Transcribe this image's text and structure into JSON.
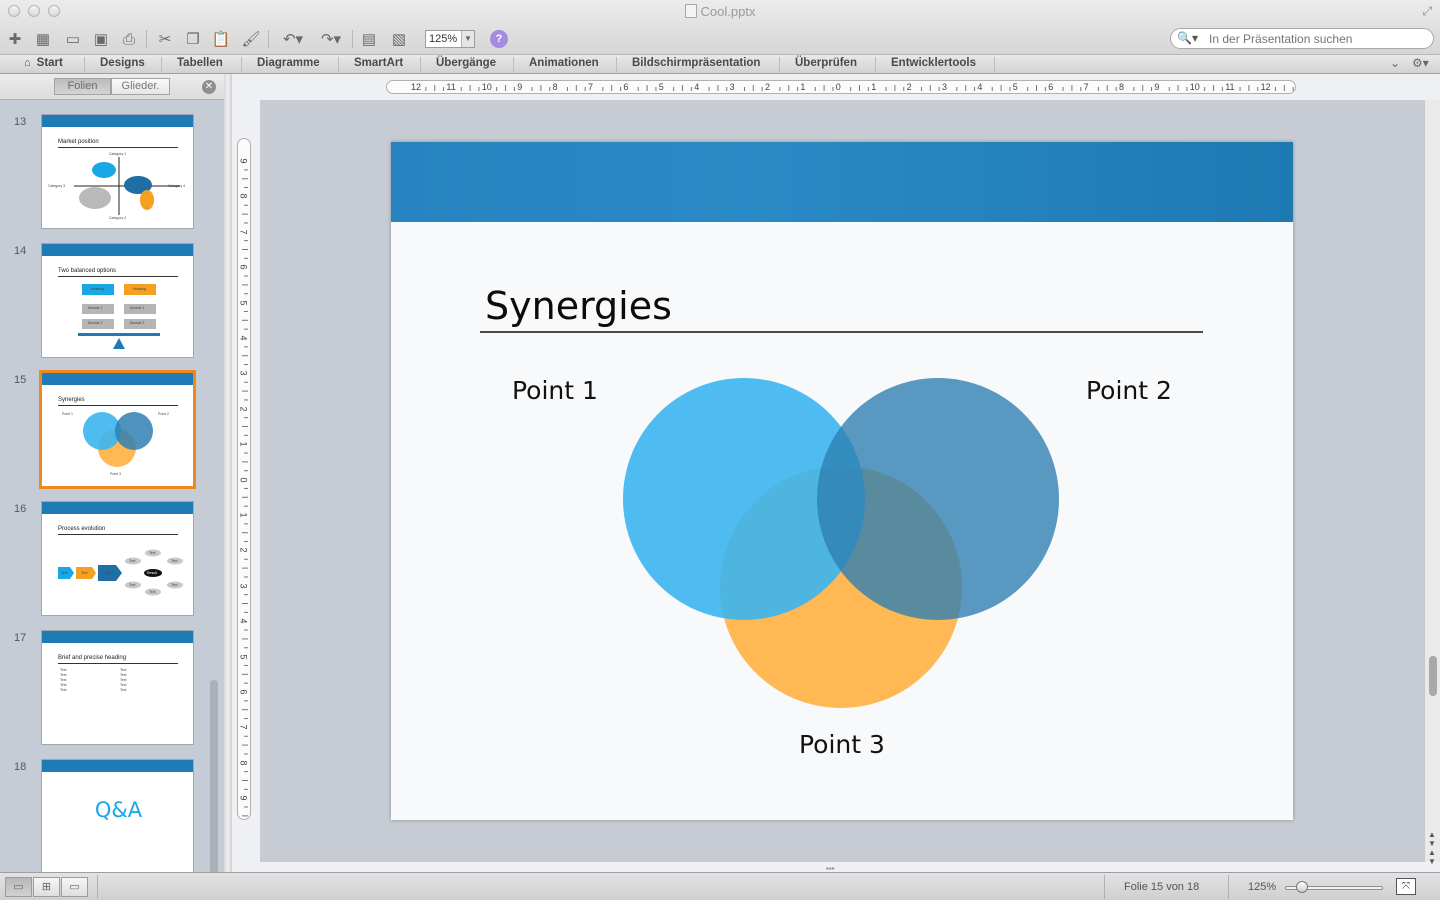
{
  "window": {
    "title": "Cool.pptx"
  },
  "toolbar": {
    "zoom_value": "125%",
    "search_placeholder": "In der Präsentation suchen"
  },
  "ribbon": {
    "tabs": [
      {
        "label": "Start"
      },
      {
        "label": "Designs"
      },
      {
        "label": "Tabellen"
      },
      {
        "label": "Diagramme"
      },
      {
        "label": "SmartArt"
      },
      {
        "label": "Übergänge"
      },
      {
        "label": "Animationen"
      },
      {
        "label": "Bildschirmpräsentation"
      },
      {
        "label": "Überprüfen"
      },
      {
        "label": "Entwicklertools"
      }
    ]
  },
  "leftpane": {
    "tab_folien": "Folien",
    "tab_gliederung": "Glieder.",
    "slides": [
      {
        "number": "13",
        "title": "Market position",
        "labels": [
          "Category 1",
          "Category 2",
          "Category 3",
          "Category 4"
        ]
      },
      {
        "number": "14",
        "title": "Two balanced options",
        "labels": [
          "Heading",
          "Heading",
          "Module 1",
          "Module 1",
          "Module 2",
          "Module 2"
        ]
      },
      {
        "number": "15",
        "title": "Synergies",
        "labels": [
          "Point 1",
          "Point 2",
          "Point 3"
        ]
      },
      {
        "number": "16",
        "title": "Process evolution",
        "labels": [
          "Text",
          "Text",
          "Text",
          "Result",
          "Text",
          "Text",
          "Text",
          "Text",
          "Text",
          "Text"
        ]
      },
      {
        "number": "17",
        "title": "Brief and precise heading",
        "labels": [
          "Text",
          "Text",
          "Text",
          "Text",
          "Text",
          "Text",
          "Text",
          "Text",
          "Text",
          "Text"
        ]
      },
      {
        "number": "18",
        "title": "Q&A"
      }
    ]
  },
  "ruler": {
    "horizontal": [
      "12",
      "11",
      "10",
      "9",
      "8",
      "7",
      "6",
      "5",
      "4",
      "3",
      "2",
      "1",
      "0",
      "1",
      "2",
      "3",
      "4",
      "5",
      "6",
      "7",
      "8",
      "9",
      "10",
      "11",
      "12"
    ],
    "vertical": [
      "9",
      "8",
      "7",
      "6",
      "5",
      "4",
      "3",
      "2",
      "1",
      "0",
      "1",
      "2",
      "3",
      "4",
      "5",
      "6",
      "7",
      "8",
      "9"
    ]
  },
  "slide": {
    "title": "Synergies",
    "points": [
      "Point 1",
      "Point 2",
      "Point 3"
    ],
    "colors": {
      "band": "#1f7bb6",
      "circle1": "#3bb5ef",
      "circle2": "#3a86b8",
      "circle3": "#ffb040"
    }
  },
  "status": {
    "slide_info": "Folie 15 von 18",
    "zoom": "125%"
  }
}
